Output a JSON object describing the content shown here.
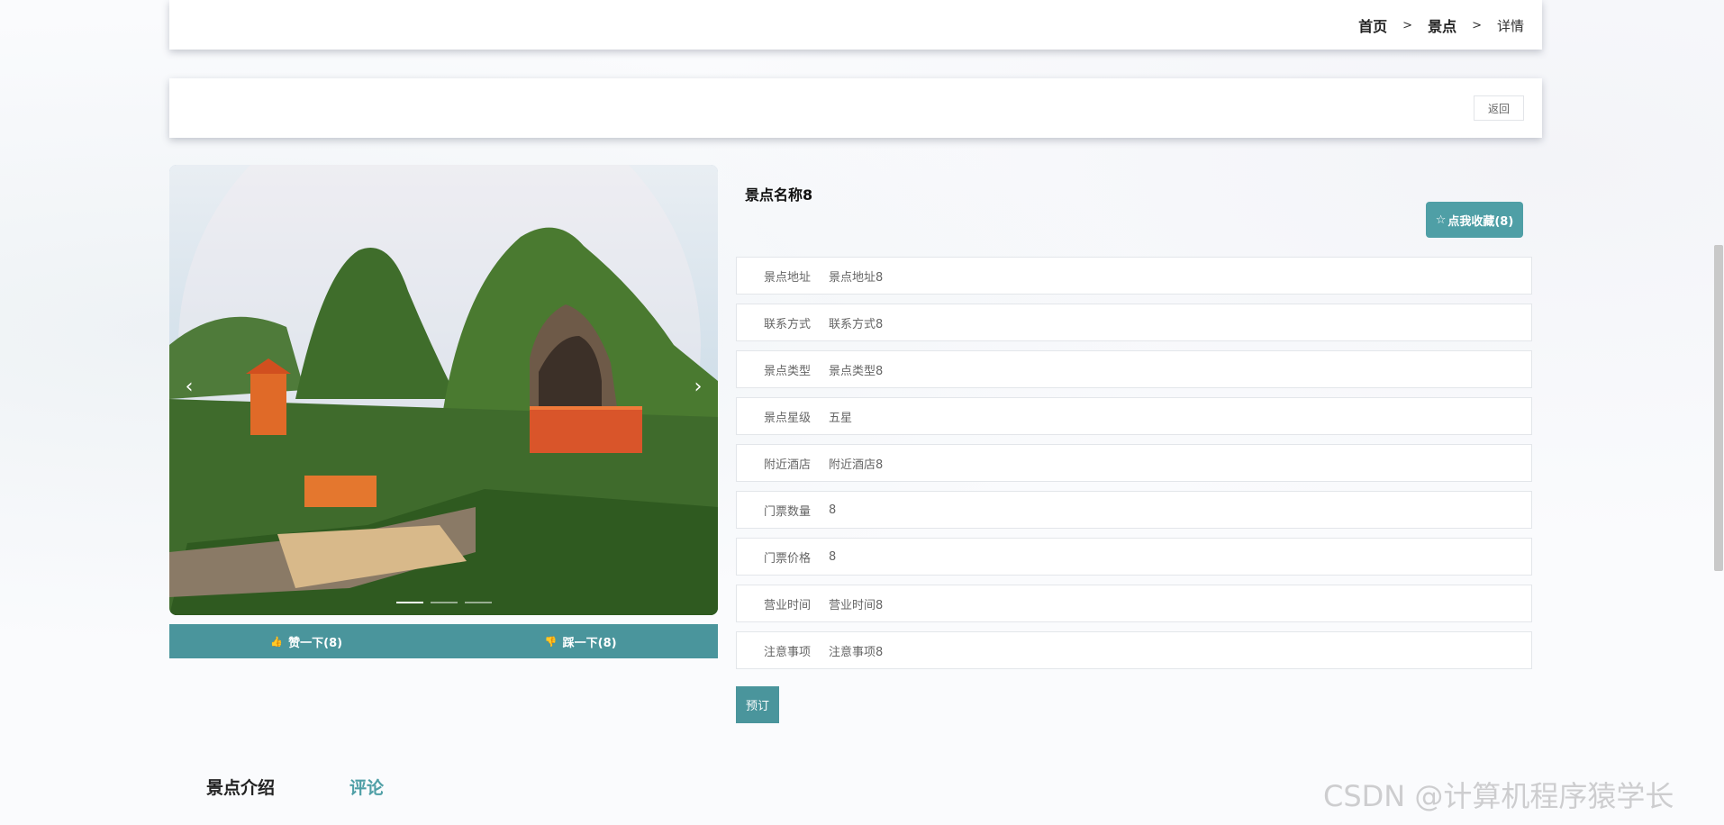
{
  "breadcrumb": {
    "home": "首页",
    "section": "景点",
    "current": "详情",
    "separator": ">"
  },
  "actions": {
    "back_label": "返回"
  },
  "carousel": {
    "prev_icon": "‹",
    "next_icon": "›",
    "slide_count": 3,
    "active_slide": 1
  },
  "votes": {
    "like_icon": "👍",
    "like_label": "赞一下(8)",
    "dislike_icon": "👎",
    "dislike_label": "踩一下(8)"
  },
  "detail": {
    "name": "景点名称8",
    "favorite_icon": "☆",
    "favorite_label": "点我收藏(8)",
    "fields": [
      {
        "label": "景点地址",
        "value": "景点地址8"
      },
      {
        "label": "联系方式",
        "value": "联系方式8"
      },
      {
        "label": "景点类型",
        "value": "景点类型8"
      },
      {
        "label": "景点星级",
        "value": "五星"
      },
      {
        "label": "附近酒店",
        "value": "附近酒店8"
      },
      {
        "label": "门票数量",
        "value": "8"
      },
      {
        "label": "门票价格",
        "value": "8"
      },
      {
        "label": "营业时间",
        "value": "营业时间8"
      },
      {
        "label": "注意事项",
        "value": "注意事项8"
      }
    ],
    "book_label": "预订"
  },
  "tabs": [
    {
      "label": "景点介绍",
      "active": false
    },
    {
      "label": "评论",
      "active": true
    }
  ],
  "watermark": "CSDN @计算机程序猿学长",
  "colors": {
    "accent": "#4a959c",
    "fav": "#4f9fa6"
  }
}
